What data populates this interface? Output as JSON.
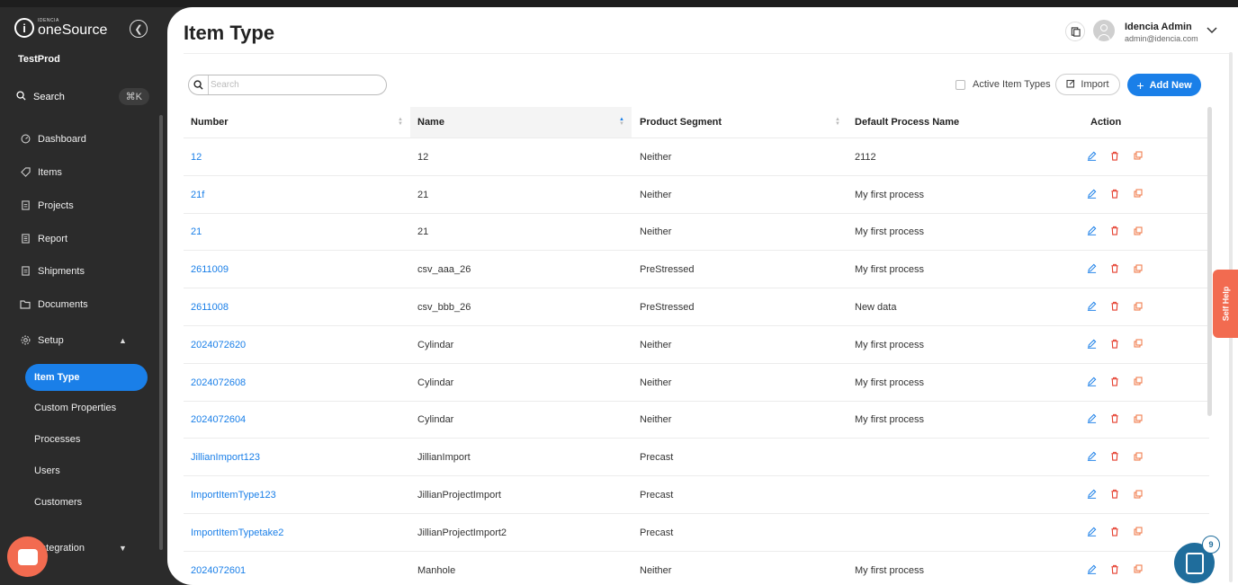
{
  "brand": {
    "company_small": "IDENCIA",
    "app_name": "oneSource",
    "logo_letter": "i"
  },
  "tenant": "TestProd",
  "sidebar": {
    "search_label": "Search",
    "search_shortcut": "⌘K",
    "items": [
      {
        "label": "Dashboard",
        "icon": "dashboard-icon"
      },
      {
        "label": "Items",
        "icon": "tag-icon"
      },
      {
        "label": "Projects",
        "icon": "document-icon"
      },
      {
        "label": "Report",
        "icon": "report-icon"
      },
      {
        "label": "Shipments",
        "icon": "document-icon"
      },
      {
        "label": "Documents",
        "icon": "folder-icon"
      }
    ],
    "setup": {
      "label": "Setup",
      "expanded": true,
      "children": [
        "Item Type",
        "Custom Properties",
        "Processes",
        "Users",
        "Customers"
      ],
      "active": "Item Type"
    },
    "integration_label": "Integration"
  },
  "header": {
    "title": "Item Type",
    "user_name": "Idencia Admin",
    "user_email": "admin@idencia.com"
  },
  "toolbar": {
    "search_placeholder": "Search",
    "active_filter_label": "Active Item Types",
    "import_label": "Import",
    "add_new_label": "Add New"
  },
  "table": {
    "columns": [
      "Number",
      "Name",
      "Product Segment",
      "Default Process Name",
      "Action"
    ],
    "rows": [
      [
        "12",
        "12",
        "Neither",
        "2112"
      ],
      [
        "21f",
        "21",
        "Neither",
        "My first process"
      ],
      [
        "21",
        "21",
        "Neither",
        "My first process"
      ],
      [
        "2611009",
        "csv_aaa_26",
        "PreStressed",
        "My first process"
      ],
      [
        "2611008",
        "csv_bbb_26",
        "PreStressed",
        "New data"
      ],
      [
        "2024072620",
        "Cylindar",
        "Neither",
        "My first process"
      ],
      [
        "2024072608",
        "Cylindar",
        "Neither",
        "My first process"
      ],
      [
        "2024072604",
        "Cylindar",
        "Neither",
        "My first process"
      ],
      [
        "JillianImport123",
        "JillianImport",
        "Precast",
        ""
      ],
      [
        "ImportItemType123",
        "JillianProjectImport",
        "Precast",
        ""
      ],
      [
        "ImportItemTypetake2",
        "JillianProjectImport2",
        "Precast",
        ""
      ],
      [
        "2024072601",
        "Manhole",
        "Neither",
        "My first process"
      ]
    ]
  },
  "self_help_label": "Self Help",
  "notifications_count": "9",
  "colors": {
    "accent": "#1a7fe8",
    "sidebar_bg": "#2b2b2b",
    "delete": "#e53e2e",
    "copy": "#f07d4f",
    "help": "#f26b50"
  }
}
